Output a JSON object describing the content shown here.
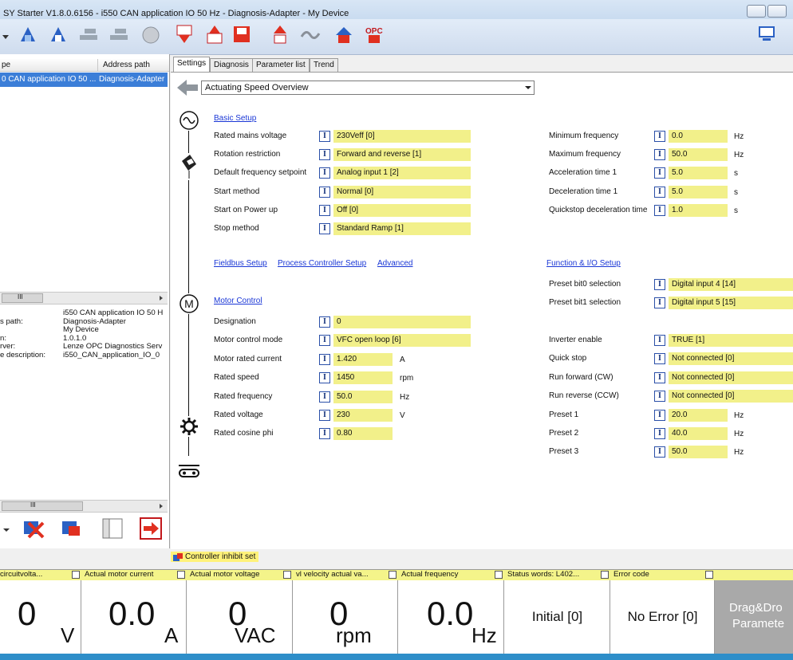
{
  "window": {
    "title": "SY Starter V1.8.0.6156 - i550 CAN application IO 50 Hz - Diagnosis-Adapter - My Device"
  },
  "tree": {
    "col_type": "pe",
    "col_address": "Address path",
    "row_type": "0 CAN application IO 50 ...",
    "row_address": "Diagnosis-Adapter",
    "scroll_marker": "III"
  },
  "properties": [
    {
      "label": "",
      "value": "i550 CAN application IO 50 H"
    },
    {
      "label": "s path:",
      "value": "Diagnosis-Adapter"
    },
    {
      "label": "",
      "value": "My Device"
    },
    {
      "label": "n:",
      "value": "1.0.1.0"
    },
    {
      "label": "rver:",
      "value": "Lenze OPC Diagnostics Serv"
    },
    {
      "label": "e description:",
      "value": "i550_CAN_application_IO_0"
    }
  ],
  "tabs": [
    {
      "label": "Settings"
    },
    {
      "label": "Diagnosis"
    },
    {
      "label": "Parameter list"
    },
    {
      "label": "Trend"
    }
  ],
  "view_selector": {
    "value": "Actuating Speed Overview"
  },
  "basic_setup": {
    "title": "Basic Setup",
    "rows": [
      {
        "label": "Rated mains voltage",
        "value": "230Veff [0]"
      },
      {
        "label": "Rotation restriction",
        "value": "Forward and reverse [1]"
      },
      {
        "label": "Default frequency setpoint",
        "value": "Analog input 1 [2]"
      },
      {
        "label": "Start method",
        "value": "Normal [0]"
      },
      {
        "label": "Start on Power up",
        "value": "Off [0]"
      },
      {
        "label": "Stop method",
        "value": "Standard Ramp [1]"
      }
    ]
  },
  "ramps": [
    {
      "label": "Minimum frequency",
      "value": "0.0",
      "unit": "Hz"
    },
    {
      "label": "Maximum frequency",
      "value": "50.0",
      "unit": "Hz"
    },
    {
      "label": "Acceleration time 1",
      "value": "5.0",
      "unit": "s"
    },
    {
      "label": "Deceleration time 1",
      "value": "5.0",
      "unit": "s"
    },
    {
      "label": "Quickstop deceleration time",
      "value": "1.0",
      "unit": "s"
    }
  ],
  "links": {
    "fieldbus": "Fieldbus Setup",
    "process_controller": "Process Controller Setup",
    "advanced": "Advanced",
    "function_io": "Function & I/O Setup"
  },
  "motor_control": {
    "title": "Motor Control",
    "rows": [
      {
        "label": "Designation",
        "value": "0",
        "unit": ""
      },
      {
        "label": "Motor control mode",
        "value": "VFC open loop [6]",
        "unit": ""
      },
      {
        "label": "Motor rated current",
        "value": "1.420",
        "unit": "A"
      },
      {
        "label": "Rated speed",
        "value": "1450",
        "unit": "rpm"
      },
      {
        "label": "Rated frequency",
        "value": "50.0",
        "unit": "Hz"
      },
      {
        "label": "Rated voltage",
        "value": "230",
        "unit": "V"
      },
      {
        "label": "Rated cosine phi",
        "value": "0.80",
        "unit": ""
      }
    ]
  },
  "presets_bits": [
    {
      "label": "Preset bit0 selection",
      "value": "Digital input 4 [14]"
    },
    {
      "label": "Preset bit1 selection",
      "value": "Digital input 5 [15]"
    }
  ],
  "function_io": [
    {
      "label": "Inverter enable",
      "value": "TRUE [1]",
      "unit": ""
    },
    {
      "label": "Quick stop",
      "value": "Not connected [0]",
      "unit": ""
    },
    {
      "label": "Run forward (CW)",
      "value": "Not connected [0]",
      "unit": ""
    },
    {
      "label": "Run reverse (CCW)",
      "value": "Not connected [0]",
      "unit": ""
    },
    {
      "label": "Preset 1",
      "value": "20.0",
      "unit": "Hz"
    },
    {
      "label": "Preset 2",
      "value": "40.0",
      "unit": "Hz"
    },
    {
      "label": "Preset 3",
      "value": "50.0",
      "unit": "Hz"
    }
  ],
  "icons": {
    "io_box": "I",
    "motor": "M"
  },
  "status": {
    "inhibit": "Controller inhibit set"
  },
  "monitor": [
    {
      "label": "circuitvolta...",
      "value": "0",
      "unit": "V"
    },
    {
      "label": "Actual motor current",
      "value": "0.0",
      "unit": "A"
    },
    {
      "label": "Actual motor voltage",
      "value": "0",
      "unit": "VAC"
    },
    {
      "label": "vl velocity actual va...",
      "value": "0",
      "unit": "rpm"
    },
    {
      "label": "Actual frequency",
      "value": "0.0",
      "unit": "Hz"
    },
    {
      "label": "Status words: L402...",
      "value": "Initial [0]",
      "unit": ""
    },
    {
      "label": "Error code",
      "value": "No Error [0]",
      "unit": ""
    }
  ],
  "dragdrop": {
    "line1": "Drag&Dro",
    "line2": "Paramete"
  },
  "colors": {
    "accent": "#3b7ed8",
    "field": "#f2f08a",
    "link": "#1a37d6",
    "status": "#2e8ec9"
  }
}
